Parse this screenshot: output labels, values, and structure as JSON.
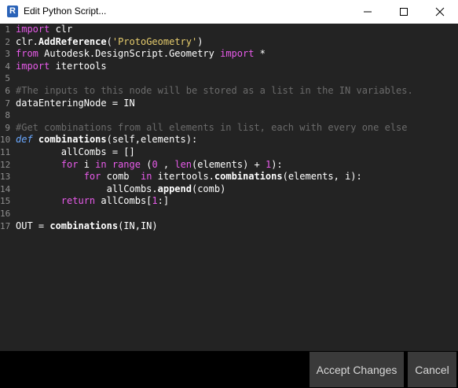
{
  "window": {
    "title": "Edit Python Script...",
    "app_icon_letter": "R"
  },
  "editor": {
    "lines": [
      {
        "n": "1",
        "tokens": [
          {
            "t": "import",
            "c": "kw"
          },
          {
            "t": " clr",
            "c": ""
          }
        ]
      },
      {
        "n": "2",
        "tokens": [
          {
            "t": "clr.",
            "c": ""
          },
          {
            "t": "AddReference",
            "c": "fn"
          },
          {
            "t": "(",
            "c": ""
          },
          {
            "t": "'ProtoGeometry'",
            "c": "str"
          },
          {
            "t": ")",
            "c": ""
          }
        ]
      },
      {
        "n": "3",
        "tokens": [
          {
            "t": "from",
            "c": "kw"
          },
          {
            "t": " Autodesk.DesignScript.Geometry ",
            "c": ""
          },
          {
            "t": "import",
            "c": "kw"
          },
          {
            "t": " *",
            "c": ""
          }
        ]
      },
      {
        "n": "4",
        "tokens": [
          {
            "t": "import",
            "c": "kw"
          },
          {
            "t": " itertools",
            "c": ""
          }
        ]
      },
      {
        "n": "5",
        "tokens": []
      },
      {
        "n": "6",
        "tokens": [
          {
            "t": "#The inputs to this node will be stored as a list in the IN variables.",
            "c": "cm"
          }
        ]
      },
      {
        "n": "7",
        "tokens": [
          {
            "t": "dataEnteringNode = IN",
            "c": ""
          }
        ]
      },
      {
        "n": "8",
        "tokens": []
      },
      {
        "n": "9",
        "tokens": [
          {
            "t": "#Get combinations from all elements in list, each with every one else",
            "c": "cm"
          }
        ]
      },
      {
        "n": "10",
        "tokens": [
          {
            "t": "def",
            "c": "kwb"
          },
          {
            "t": " ",
            "c": ""
          },
          {
            "t": "combinations",
            "c": "fn"
          },
          {
            "t": "(self,elements):",
            "c": ""
          }
        ]
      },
      {
        "n": "11",
        "tokens": [
          {
            "t": "        allCombs = []",
            "c": ""
          }
        ]
      },
      {
        "n": "12",
        "tokens": [
          {
            "t": "        ",
            "c": ""
          },
          {
            "t": "for",
            "c": "kw"
          },
          {
            "t": " i ",
            "c": ""
          },
          {
            "t": "in",
            "c": "kw"
          },
          {
            "t": " ",
            "c": ""
          },
          {
            "t": "range",
            "c": "kw"
          },
          {
            "t": " (",
            "c": ""
          },
          {
            "t": "0",
            "c": "num"
          },
          {
            "t": " , ",
            "c": ""
          },
          {
            "t": "len",
            "c": "kw"
          },
          {
            "t": "(elements) + ",
            "c": ""
          },
          {
            "t": "1",
            "c": "num"
          },
          {
            "t": "):",
            "c": ""
          }
        ]
      },
      {
        "n": "13",
        "tokens": [
          {
            "t": "            ",
            "c": ""
          },
          {
            "t": "for",
            "c": "kw"
          },
          {
            "t": " comb  ",
            "c": ""
          },
          {
            "t": "in",
            "c": "kw"
          },
          {
            "t": " itertools.",
            "c": ""
          },
          {
            "t": "combinations",
            "c": "fn"
          },
          {
            "t": "(elements, i):",
            "c": ""
          }
        ]
      },
      {
        "n": "14",
        "tokens": [
          {
            "t": "                allCombs.",
            "c": ""
          },
          {
            "t": "append",
            "c": "fn"
          },
          {
            "t": "(comb)",
            "c": ""
          }
        ]
      },
      {
        "n": "15",
        "tokens": [
          {
            "t": "        ",
            "c": ""
          },
          {
            "t": "return",
            "c": "kw"
          },
          {
            "t": " allCombs[",
            "c": ""
          },
          {
            "t": "1",
            "c": "num"
          },
          {
            "t": ":]",
            "c": ""
          }
        ]
      },
      {
        "n": "16",
        "tokens": []
      },
      {
        "n": "17",
        "tokens": [
          {
            "t": "OUT = ",
            "c": ""
          },
          {
            "t": "combinations",
            "c": "fn"
          },
          {
            "t": "(IN,IN)",
            "c": ""
          }
        ]
      }
    ]
  },
  "footer": {
    "accept_label": "Accept Changes",
    "cancel_label": "Cancel"
  },
  "icons": {
    "minimize": "minimize-icon",
    "maximize": "maximize-icon",
    "close": "close-icon"
  }
}
